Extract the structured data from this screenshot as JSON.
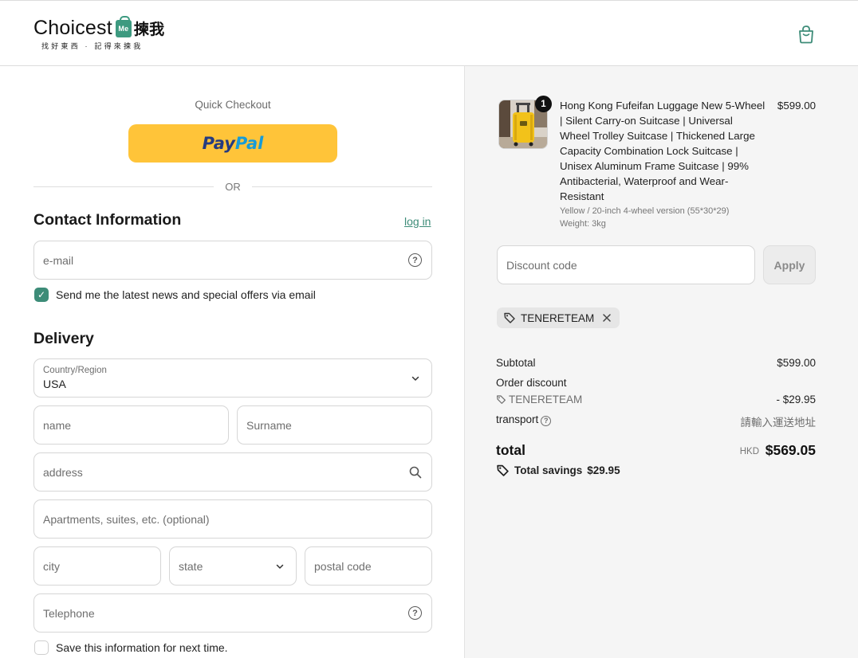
{
  "header": {
    "logo_main": "Choicest",
    "logo_badge": "Me",
    "logo_cn": "揀我",
    "logo_tagline": "找好東西 · 記得來揀我",
    "cart_icon": "shopping-bag-icon"
  },
  "checkout": {
    "quick_checkout": "Quick Checkout",
    "paypal_pay": "Pay",
    "paypal_pal": "Pal",
    "or": "OR"
  },
  "contact": {
    "heading": "Contact Information",
    "login": "log in",
    "email_placeholder": "e-mail",
    "newsletter_label": "Send me the latest news and special offers via email",
    "newsletter_checked": true
  },
  "delivery": {
    "heading": "Delivery",
    "country_label": "Country/Region",
    "country_value": "USA",
    "name_placeholder": "name",
    "surname_placeholder": "Surname",
    "address_placeholder": "address",
    "apartment_placeholder": "Apartments, suites, etc. (optional)",
    "city_placeholder": "city",
    "state_placeholder": "state",
    "postal_placeholder": "postal code",
    "phone_placeholder": "Telephone",
    "save_info_label": "Save this information for next time.",
    "save_info_checked": false
  },
  "order": {
    "quantity": "1",
    "product_title": "Hong Kong Fufeifan Luggage New 5-Wheel | Silent Carry-on Suitcase | Universal Wheel Trolley Suitcase | Thickened Large Capacity Combination Lock Suitcase | Unisex Aluminum Frame Suitcase | 99% Antibacterial, Waterproof and Wear-Resistant",
    "product_variant": "Yellow / 20-inch 4-wheel version (55*30*29)",
    "product_weight": "Weight: 3kg",
    "product_price": "$599.00",
    "discount_placeholder": "Discount code",
    "apply_label": "Apply",
    "applied_code": "TENERETEAM",
    "subtotal_label": "Subtotal",
    "subtotal_value": "$599.00",
    "order_discount_label": "Order discount",
    "discount_code_name": "TENERETEAM",
    "discount_value": "- $29.95",
    "transport_label": "transport",
    "transport_value": "請輸入運送地址",
    "total_label": "total",
    "total_currency": "HKD",
    "total_value": "$569.05",
    "savings_label": "Total savings",
    "savings_value": "$29.95"
  },
  "colors": {
    "accent": "#3d8c78",
    "paypal_yellow": "#ffc439",
    "summary_bg": "#f5f5f5"
  }
}
